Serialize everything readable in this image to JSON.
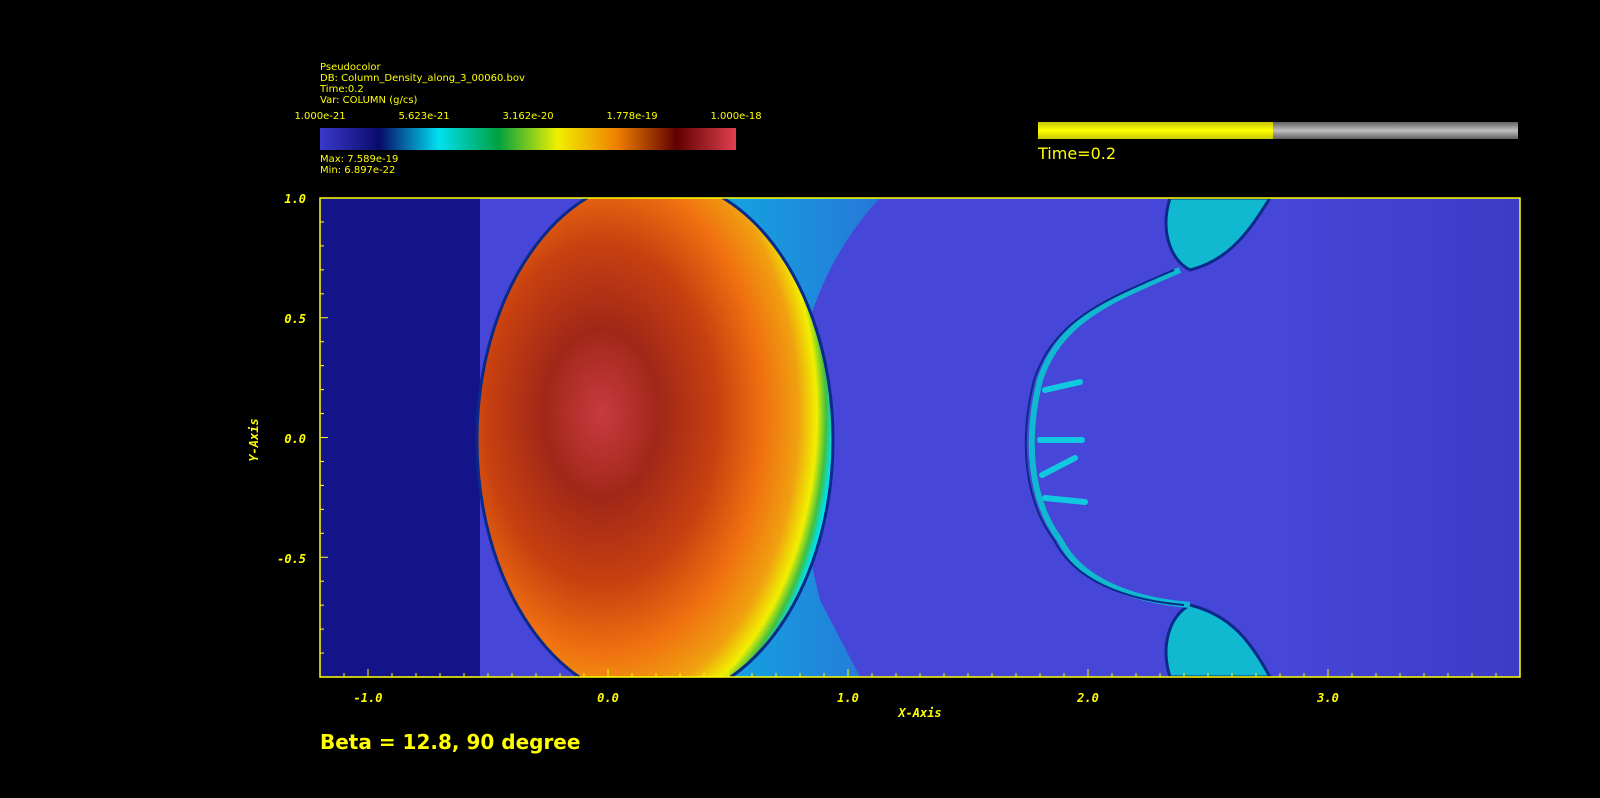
{
  "legend": {
    "plot_type": "Pseudocolor",
    "db": "DB: Column_Density_along_3_00060.bov",
    "time": "Time:0.2",
    "var": "Var: COLUMN (g/cs)",
    "tick_labels": [
      "1.000e-21",
      "5.623e-21",
      "3.162e-20",
      "1.778e-19",
      "1.000e-18"
    ],
    "max": "Max:  7.589e-19",
    "min": "Min:  6.897e-22",
    "colormap": [
      "#3a3acc",
      "#0a0a6a",
      "#00e0f0",
      "#00a040",
      "#f0f000",
      "#f08000",
      "#600000",
      "#e04050"
    ]
  },
  "time_slider": {
    "label": "Time=0.2",
    "progress": 0.49,
    "fill_color": "#ffff00",
    "track_color": "#8c8c8c"
  },
  "plot": {
    "x_axis_title": "X-Axis",
    "y_axis_title": "Y-Axis",
    "x_range": [
      -1.2,
      3.8
    ],
    "y_range": [
      -1.0,
      1.0
    ],
    "x_ticks": [
      "-1.0",
      "0.0",
      "1.0",
      "2.0",
      "3.0"
    ],
    "y_ticks": [
      "1.0",
      "0.5",
      "0.0",
      "-0.5"
    ],
    "frame_color": "#ffff00",
    "background_color": "#4646d8"
  },
  "caption": "Beta = 12.8, 90 degree"
}
